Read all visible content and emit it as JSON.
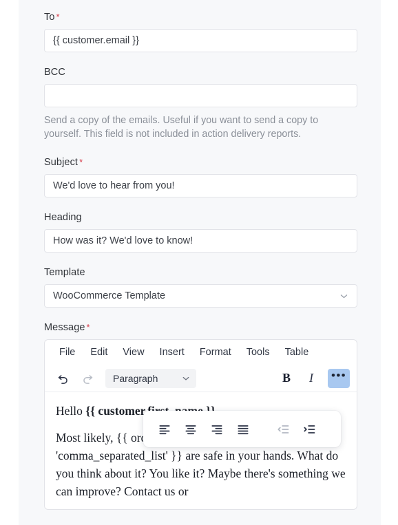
{
  "fields": {
    "to": {
      "label": "To",
      "required": "*",
      "value": "{{ customer.email }}"
    },
    "bcc": {
      "label": "BCC",
      "value": "",
      "help": "Send a copy of the emails. Useful if you want to send a copy to yourself. This field is not included in action delivery reports."
    },
    "subject": {
      "label": "Subject",
      "required": "*",
      "value": "We'd love to hear from you!"
    },
    "heading": {
      "label": "Heading",
      "value": "How was it? We'd love to know!"
    },
    "template": {
      "label": "Template",
      "value": "WooCommerce Template"
    },
    "message": {
      "label": "Message",
      "required": "*"
    }
  },
  "editor": {
    "menubar": [
      {
        "label": "File"
      },
      {
        "label": "Edit"
      },
      {
        "label": "View"
      },
      {
        "label": "Insert"
      },
      {
        "label": "Format"
      },
      {
        "label": "Tools"
      },
      {
        "label": "Table"
      }
    ],
    "toolbar": {
      "undo": "undo-icon",
      "redo": "redo-icon",
      "format_block": "Paragraph",
      "bold": "B",
      "italic": "I",
      "more": "•••"
    },
    "overflow_popup": {
      "items": [
        {
          "name": "align-left-icon",
          "enabled": true
        },
        {
          "name": "align-center-icon",
          "enabled": true
        },
        {
          "name": "align-right-icon",
          "enabled": true
        },
        {
          "name": "align-justify-icon",
          "enabled": true
        },
        {
          "name": "outdent-icon",
          "enabled": false
        },
        {
          "name": "indent-icon",
          "enabled": true
        }
      ]
    },
    "content": {
      "greeting_plain": "Hello ",
      "greeting_bold": "{{ customer.first_name }}",
      "paragraph": "Most likely, {{ order.products_ordered | template: 'comma_separated_list' }} are safe in your hands. What do you think about it? You like it? Maybe there's something we can improve? Contact us or"
    }
  },
  "colors": {
    "panel_bg": "#f7f8fa",
    "input_border": "#e2e3e8",
    "required_red": "#d63a47",
    "help_text": "#8a8f98",
    "more_button_bg": "#a8c8f0"
  }
}
